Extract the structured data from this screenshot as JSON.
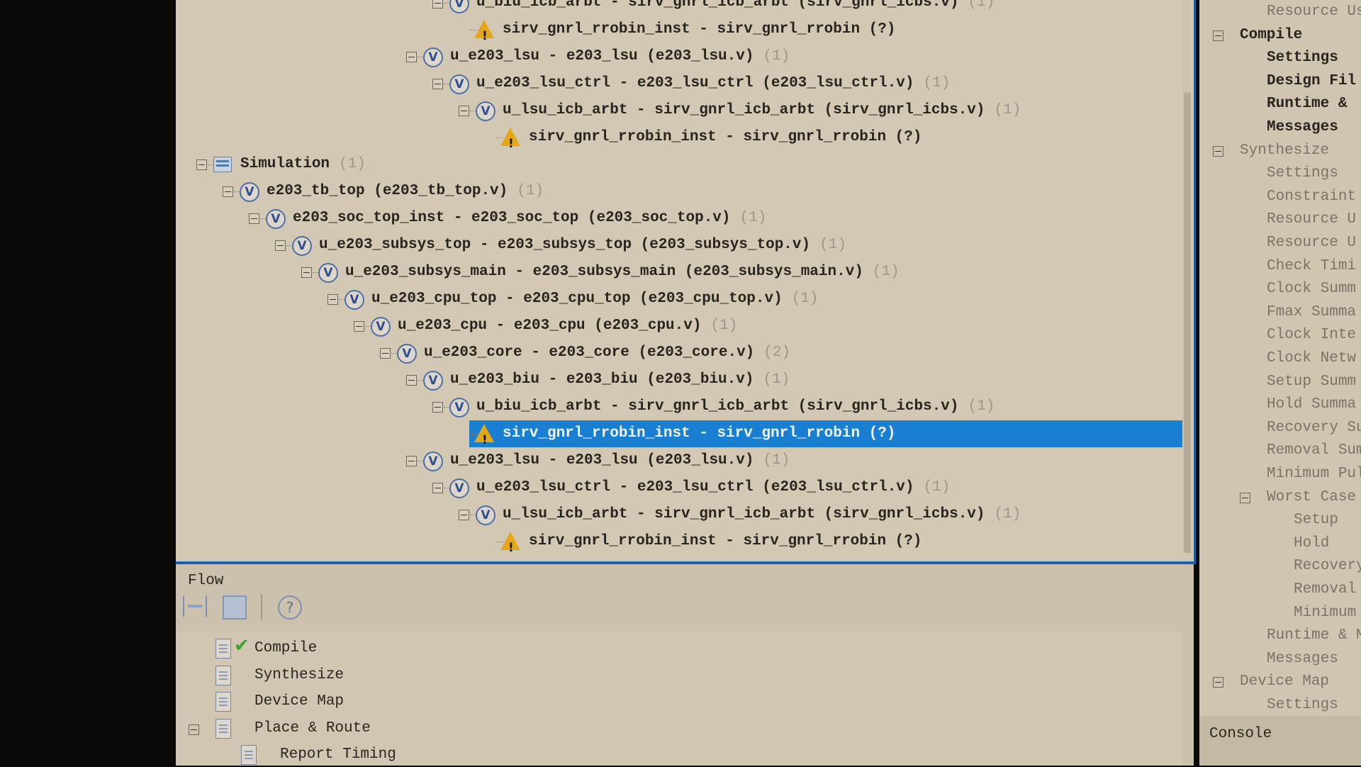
{
  "hierarchy": {
    "rows": [
      {
        "label": "u_biu_icb_arbt - sirv_gnrl_icb_arbt (sirv_gnrl_icbs.v)",
        "count": "(1)",
        "level": 9,
        "icon": "verilog",
        "expandable": true
      },
      {
        "label": "sirv_gnrl_rrobin_inst - sirv_gnrl_rrobin (?)",
        "count": "",
        "level": 10,
        "icon": "warning",
        "expandable": false
      },
      {
        "label": "u_e203_lsu - e203_lsu (e203_lsu.v)",
        "count": "(1)",
        "level": 8,
        "icon": "verilog",
        "expandable": true
      },
      {
        "label": "u_e203_lsu_ctrl - e203_lsu_ctrl (e203_lsu_ctrl.v)",
        "count": "(1)",
        "level": 9,
        "icon": "verilog",
        "expandable": true
      },
      {
        "label": "u_lsu_icb_arbt - sirv_gnrl_icb_arbt (sirv_gnrl_icbs.v)",
        "count": "(1)",
        "level": 10,
        "icon": "verilog",
        "expandable": true
      },
      {
        "label": "sirv_gnrl_rrobin_inst - sirv_gnrl_rrobin (?)",
        "count": "",
        "level": 11,
        "icon": "warning",
        "expandable": false
      },
      {
        "label": "Simulation",
        "count": "(1)",
        "level": 0,
        "icon": "simulation",
        "expandable": true
      },
      {
        "label": "e203_tb_top (e203_tb_top.v)",
        "count": "(1)",
        "level": 1,
        "icon": "verilog",
        "expandable": true
      },
      {
        "label": "e203_soc_top_inst - e203_soc_top (e203_soc_top.v)",
        "count": "(1)",
        "level": 2,
        "icon": "verilog",
        "expandable": true
      },
      {
        "label": "u_e203_subsys_top - e203_subsys_top (e203_subsys_top.v)",
        "count": "(1)",
        "level": 3,
        "icon": "verilog",
        "expandable": true
      },
      {
        "label": "u_e203_subsys_main - e203_subsys_main (e203_subsys_main.v)",
        "count": "(1)",
        "level": 4,
        "icon": "verilog",
        "expandable": true
      },
      {
        "label": "u_e203_cpu_top - e203_cpu_top (e203_cpu_top.v)",
        "count": "(1)",
        "level": 5,
        "icon": "verilog",
        "expandable": true
      },
      {
        "label": "u_e203_cpu - e203_cpu (e203_cpu.v)",
        "count": "(1)",
        "level": 6,
        "icon": "verilog",
        "expandable": true
      },
      {
        "label": "u_e203_core - e203_core (e203_core.v)",
        "count": "(2)",
        "level": 7,
        "icon": "verilog",
        "expandable": true
      },
      {
        "label": "u_e203_biu - e203_biu (e203_biu.v)",
        "count": "(1)",
        "level": 8,
        "icon": "verilog",
        "expandable": true
      },
      {
        "label": "u_biu_icb_arbt - sirv_gnrl_icb_arbt (sirv_gnrl_icbs.v)",
        "count": "(1)",
        "level": 9,
        "icon": "verilog",
        "expandable": true
      },
      {
        "label": "sirv_gnrl_rrobin_inst - sirv_gnrl_rrobin (?)",
        "count": "",
        "level": 10,
        "icon": "warning",
        "expandable": false,
        "selected": true
      },
      {
        "label": "u_e203_lsu - e203_lsu (e203_lsu.v)",
        "count": "(1)",
        "level": 8,
        "icon": "verilog",
        "expandable": true
      },
      {
        "label": "u_e203_lsu_ctrl - e203_lsu_ctrl (e203_lsu_ctrl.v)",
        "count": "(1)",
        "level": 9,
        "icon": "verilog",
        "expandable": true
      },
      {
        "label": "u_lsu_icb_arbt - sirv_gnrl_icb_arbt (sirv_gnrl_icbs.v)",
        "count": "(1)",
        "level": 10,
        "icon": "verilog",
        "expandable": true
      },
      {
        "label": "sirv_gnrl_rrobin_inst - sirv_gnrl_rrobin (?)",
        "count": "",
        "level": 11,
        "icon": "warning",
        "expandable": false
      }
    ],
    "verilog_icon_glyph": "V",
    "warning_icon_glyph": "!",
    "selection_color": "#1a7fd0"
  },
  "flow": {
    "title": "Flow",
    "toolbar": {
      "expand_all_icon": "expand-all-icon",
      "collapse_all_icon": "collapse-all-icon",
      "help_glyph": "?"
    },
    "items": [
      {
        "label": "Compile",
        "level": 0,
        "status": "done"
      },
      {
        "label": "Synthesize",
        "level": 0,
        "status": ""
      },
      {
        "label": "Device Map",
        "level": 0,
        "status": ""
      },
      {
        "label": "Place & Route",
        "level": 0,
        "status": "",
        "expandable": true
      },
      {
        "label": "Report Timing",
        "level": 1,
        "status": ""
      }
    ]
  },
  "report": {
    "items": [
      {
        "label": "Resource Usag",
        "level": 1,
        "dark": false
      },
      {
        "label": "Compile",
        "level": 0,
        "dark": true,
        "expandable": true
      },
      {
        "label": "Settings",
        "level": 1,
        "dark": true
      },
      {
        "label": "Design Fil",
        "level": 1,
        "dark": true
      },
      {
        "label": "Runtime &",
        "level": 1,
        "dark": true
      },
      {
        "label": "Messages",
        "level": 1,
        "dark": true
      },
      {
        "label": "Synthesize",
        "level": 0,
        "dark": false,
        "expandable": true
      },
      {
        "label": "Settings",
        "level": 1
      },
      {
        "label": "Constraint",
        "level": 1
      },
      {
        "label": "Resource U",
        "level": 1
      },
      {
        "label": "Resource U",
        "level": 1
      },
      {
        "label": "Check Timi",
        "level": 1
      },
      {
        "label": "Clock Summ",
        "level": 1
      },
      {
        "label": "Fmax Summa",
        "level": 1
      },
      {
        "label": "Clock Inte",
        "level": 1
      },
      {
        "label": "Clock Netw",
        "level": 1
      },
      {
        "label": "Setup Summ",
        "level": 1
      },
      {
        "label": "Hold Summa",
        "level": 1
      },
      {
        "label": "Recovery Su",
        "level": 1
      },
      {
        "label": "Removal Sum",
        "level": 1
      },
      {
        "label": "Minimum Pul",
        "level": 1
      },
      {
        "label": "Worst Case",
        "level": 1,
        "expandable": true
      },
      {
        "label": "Setup",
        "level": 2
      },
      {
        "label": "Hold",
        "level": 2
      },
      {
        "label": "Recovery",
        "level": 2
      },
      {
        "label": "Removal",
        "level": 2
      },
      {
        "label": "Minimum",
        "level": 2
      },
      {
        "label": "Runtime & M",
        "level": 1
      },
      {
        "label": "Messages",
        "level": 1
      },
      {
        "label": "Device Map",
        "level": 0,
        "expandable": true
      },
      {
        "label": "Settings",
        "level": 1
      }
    ]
  },
  "console": {
    "title": "Console"
  }
}
